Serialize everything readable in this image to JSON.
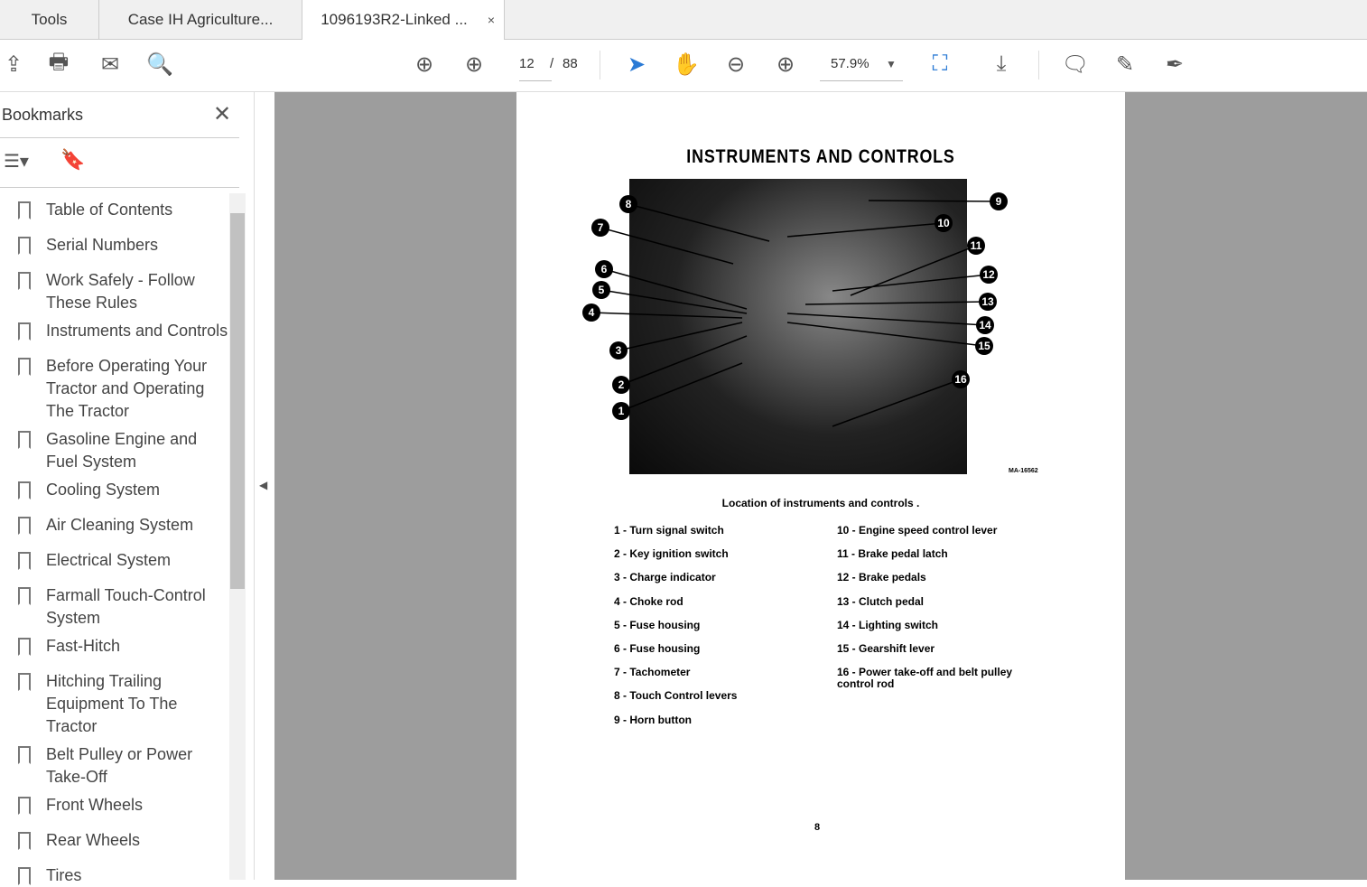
{
  "tabs": [
    {
      "label": "Tools"
    },
    {
      "label": "Case IH Agriculture..."
    },
    {
      "label": "1096193R2-Linked ...",
      "close": "×"
    }
  ],
  "toolbar": {
    "page_current": "12",
    "page_sep": "/",
    "page_total": "88",
    "zoom": "57.9%"
  },
  "sidebar": {
    "title": "Bookmarks",
    "close": "✕",
    "items": [
      {
        "label": "Table of Contents"
      },
      {
        "label": "Serial Numbers"
      },
      {
        "label": "Work Safely - Follow These Rules"
      },
      {
        "label": "Instruments and Controls"
      },
      {
        "label": "Before Operating Your Tractor and Operating The Tractor"
      },
      {
        "label": "Gasoline Engine and Fuel System"
      },
      {
        "label": "Cooling System"
      },
      {
        "label": "Air Cleaning System"
      },
      {
        "label": "Electrical System"
      },
      {
        "label": "Farmall Touch-Control System"
      },
      {
        "label": "Fast-Hitch"
      },
      {
        "label": "Hitching Trailing Equipment To The Tractor"
      },
      {
        "label": "Belt Pulley or Power Take-Off"
      },
      {
        "label": "Front Wheels"
      },
      {
        "label": "Rear Wheels"
      },
      {
        "label": "Tires"
      }
    ]
  },
  "document": {
    "title": "INSTRUMENTS AND CONTROLS",
    "figure_id": "MA-16562",
    "caption": "Location of instruments and controls .",
    "page_number": "8",
    "callouts": [
      "1",
      "2",
      "3",
      "4",
      "5",
      "6",
      "7",
      "8",
      "9",
      "10",
      "11",
      "12",
      "13",
      "14",
      "15",
      "16"
    ],
    "items": [
      "1 - Turn signal switch",
      "2 - Key ignition switch",
      "3 - Charge indicator",
      "4 - Choke rod",
      "5 - Fuse housing",
      "6 - Fuse housing",
      "7 - Tachometer",
      "8 - Touch Control levers",
      "9 - Horn button",
      "10 - Engine speed control lever",
      "11 - Brake pedal latch",
      "12 - Brake pedals",
      "13 - Clutch pedal",
      "14 - Lighting switch",
      "15 - Gearshift lever",
      "16 - Power take-off and belt pulley control rod"
    ]
  }
}
